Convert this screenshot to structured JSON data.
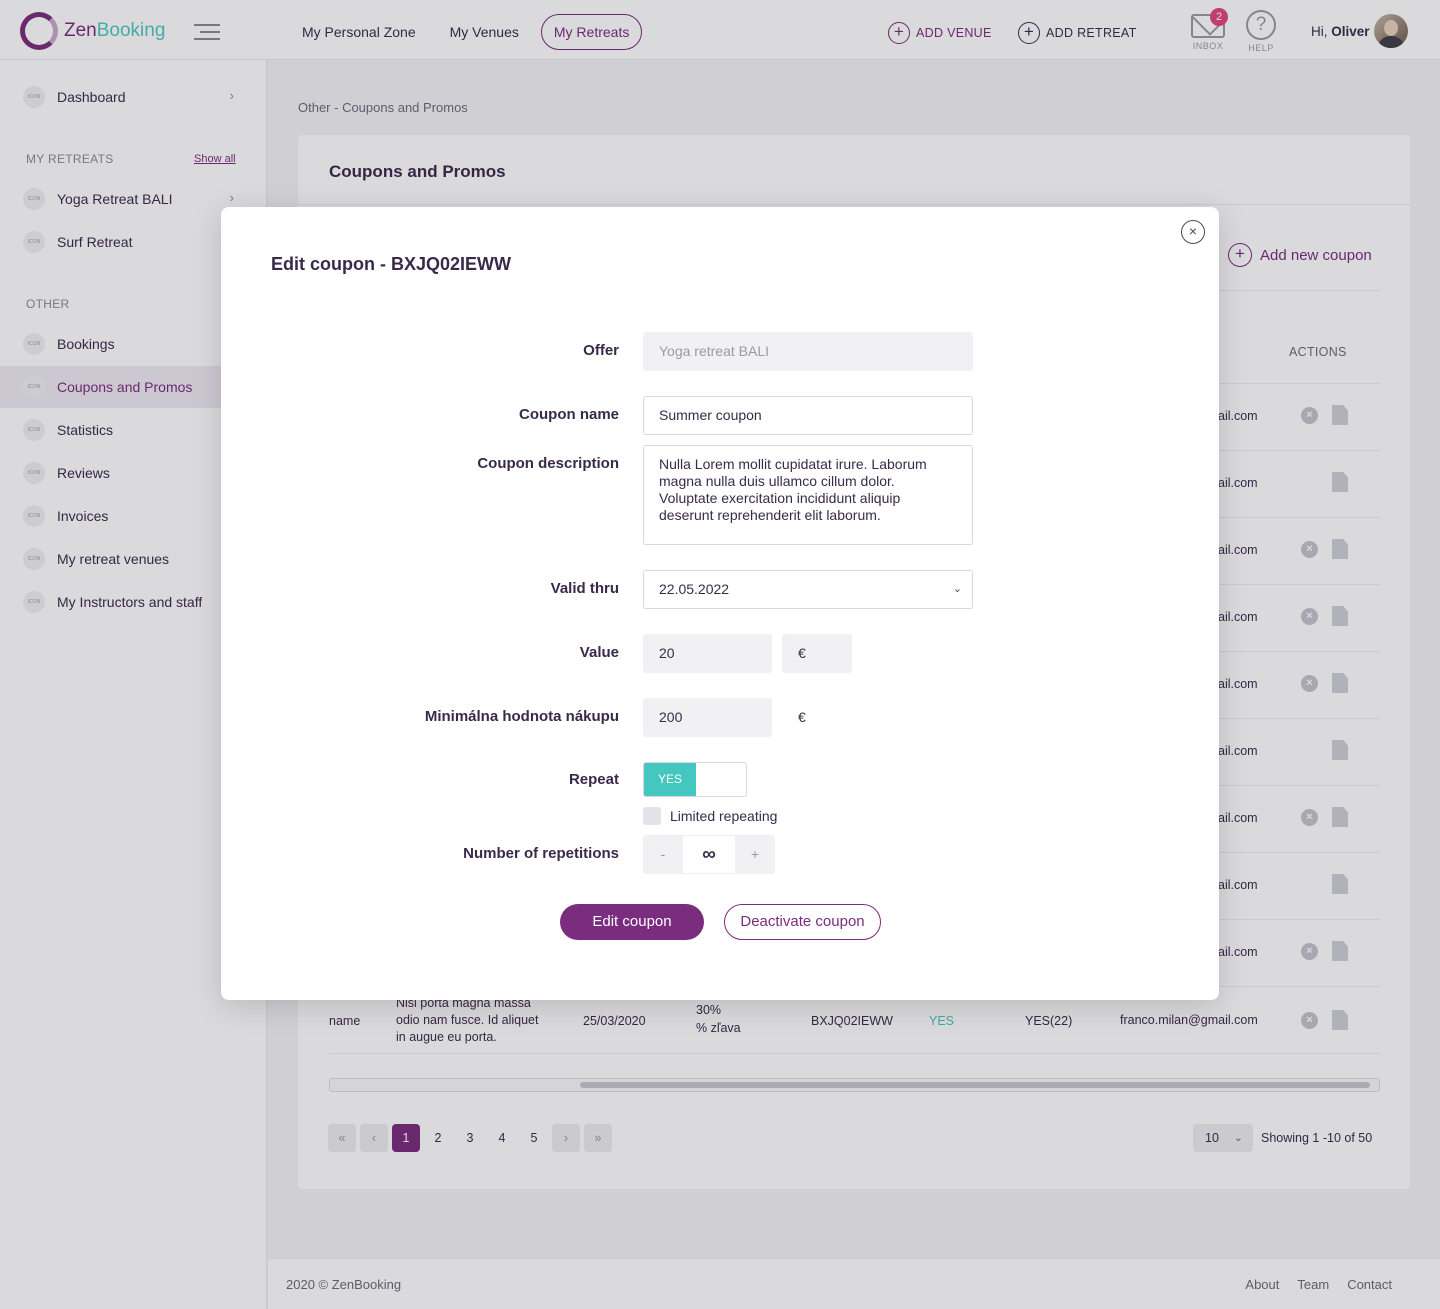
{
  "header": {
    "logo_prefix": "Zen",
    "logo_suffix": "Booking",
    "nav": [
      "My Personal Zone",
      "My Venues",
      "My Retreats"
    ],
    "add_venue": "ADD VENUE",
    "add_retreat": "ADD RETREAT",
    "inbox_label": "INBOX",
    "inbox_count": "2",
    "help_label": "HELP",
    "greeting_prefix": "Hi,",
    "user_name": "Oliver",
    "brand_color": "#7a2c7e",
    "accent_color": "#44c7bf"
  },
  "sidebar": {
    "dashboard": "Dashboard",
    "icon_placeholder": "ICON",
    "my_retreats_section": "MY RETREATS",
    "show_all": "Show all",
    "retreats": [
      "Yoga Retreat BALI",
      "Surf Retreat"
    ],
    "other_section": "OTHER",
    "other_items": [
      "Bookings",
      "Coupons and Promos",
      "Statistics",
      "Reviews",
      "Invoices",
      "My retreat venues",
      "My Instructors and staff"
    ]
  },
  "main": {
    "breadcrumb": "Other - Coupons and Promos",
    "title": "Coupons and Promos",
    "add_coupon": "Add new coupon",
    "actions_header": "ACTIONS",
    "email_fragment": "ail.com",
    "last_row": {
      "name": "name",
      "description": "Nisi porta magna massa odio nam fusce. Id aliquet in augue eu porta.",
      "date": "25/03/2020",
      "value": "30%",
      "discount_label": "% zľava",
      "code": "BXJQ02IEWW",
      "active": "YES",
      "repeat": "YES(22)",
      "email": "franco.milan@gmail.com"
    },
    "pager": {
      "first": "«",
      "prev": "‹",
      "next": "›",
      "last": "»",
      "pages": [
        "1",
        "2",
        "3",
        "4",
        "5"
      ],
      "per_page": "10",
      "showing": "Showing 1 -10 of 50"
    }
  },
  "footer": {
    "copyright": "2020 © ZenBooking",
    "links": [
      "About",
      "Team",
      "Contact"
    ]
  },
  "modal": {
    "title": "Edit coupon - BXJQ02IEWW",
    "close": "×",
    "offer_label": "Offer",
    "offer_value": "Yoga retreat BALI",
    "name_label": "Coupon name",
    "name_value": "Summer coupon",
    "description_label": "Coupon description",
    "description_value": "Nulla Lorem mollit cupidatat irure. Laborum magna nulla duis ullamco cillum dolor. Voluptate exercitation incididunt aliquip deserunt reprehenderit elit laborum.",
    "valid_label": "Valid thru",
    "valid_value": "22.05.2022",
    "value_label": "Value",
    "value_amount": "20",
    "value_currency": "€",
    "min_label": "Minimálna hodnota nákupu",
    "min_amount": "200",
    "min_currency": "€",
    "repeat_label": "Repeat",
    "repeat_on": "YES",
    "limited_label": "Limited repeating",
    "repetitions_label": "Number of repetitions",
    "stepper_minus": "-",
    "stepper_value": "∞",
    "stepper_plus": "+",
    "edit_button": "Edit coupon",
    "deactivate_button": "Deactivate coupon"
  }
}
